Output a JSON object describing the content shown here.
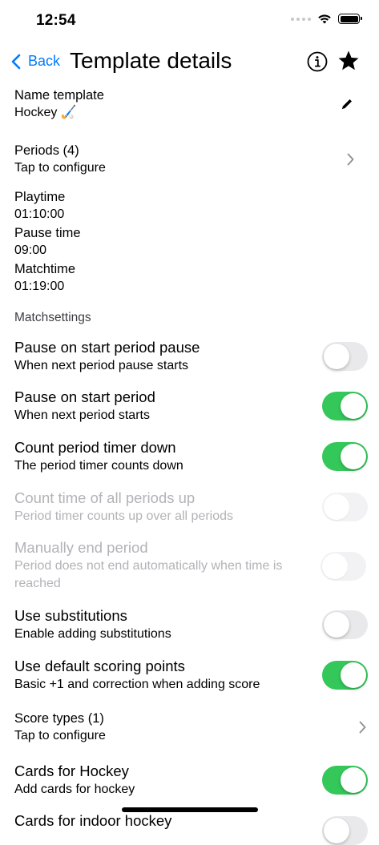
{
  "status": {
    "time": "12:54"
  },
  "nav": {
    "back_label": "Back",
    "title": "Template details"
  },
  "name_template": {
    "label": "Name template",
    "value": "Hockey 🏑"
  },
  "periods": {
    "label": "Periods (4)",
    "sub": "Tap to configure"
  },
  "times": {
    "playtime_label": "Playtime",
    "playtime_value": "01:10:00",
    "pause_label": "Pause time",
    "pause_value": "09:00",
    "matchtime_label": "Matchtime",
    "matchtime_value": "01:19:00"
  },
  "section": {
    "matchsettings": "Matchsettings"
  },
  "settings": [
    {
      "title": "Pause on start period pause",
      "sub": "When next period pause starts",
      "state": "off"
    },
    {
      "title": "Pause on start period",
      "sub": "When next period starts",
      "state": "on"
    },
    {
      "title": "Count period timer down",
      "sub": "The period timer counts down",
      "state": "on"
    },
    {
      "title": "Count time of all periods up",
      "sub": "Period timer counts up over all periods",
      "state": "disabled"
    },
    {
      "title": "Manually end period",
      "sub": "Period does not end automatically when time is reached",
      "state": "disabled"
    },
    {
      "title": "Use substitutions",
      "sub": "Enable adding substitutions",
      "state": "off"
    },
    {
      "title": "Use default scoring points",
      "sub": "Basic +1 and correction when adding score",
      "state": "on"
    }
  ],
  "score_types": {
    "label": "Score types (1)",
    "sub": "Tap to configure"
  },
  "cards_hockey": {
    "title": "Cards for Hockey",
    "sub": "Add cards for hockey",
    "state": "on"
  },
  "cards_indoor": {
    "title": "Cards for indoor hockey",
    "state": "off"
  },
  "colors": {
    "accent": "#007aff",
    "toggle_on": "#34c759",
    "toggle_off": "#e9e9eb",
    "disabled_text": "#b3b3b8"
  }
}
